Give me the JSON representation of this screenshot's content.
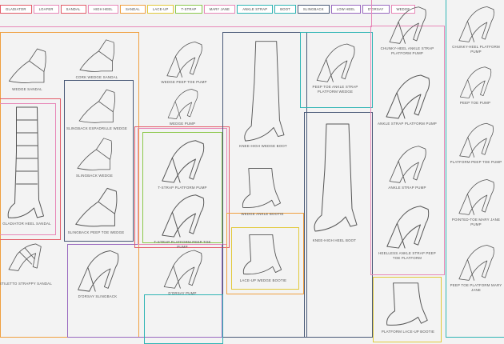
{
  "colors": {
    "red": "#e35d6a",
    "pink": "#e888b8",
    "orange": "#f0a040",
    "yellow": "#e2c93a",
    "green": "#8cc84b",
    "teal": "#2fb5b5",
    "navy": "#4a5a78",
    "purple": "#9a6ac0",
    "gray": "#888888"
  },
  "legend": [
    {
      "label": "Gladiator",
      "color": "red"
    },
    {
      "label": "Loafer",
      "color": "pink"
    },
    {
      "label": "Sandal",
      "color": "red"
    },
    {
      "label": "High Heel",
      "color": "pink"
    },
    {
      "label": "Sandal",
      "color": "orange"
    },
    {
      "label": "Lace-Up",
      "color": "yellow"
    },
    {
      "label": "T-Strap",
      "color": "green"
    },
    {
      "label": "Mary Jane",
      "color": "pink"
    },
    {
      "label": "Ankle Strap",
      "color": "teal"
    },
    {
      "label": "Boot",
      "color": "teal"
    },
    {
      "label": "Slingback",
      "color": "navy"
    },
    {
      "label": "Low Heel",
      "color": "purple"
    },
    {
      "label": "D'orsay",
      "color": "purple"
    },
    {
      "label": "Wedge",
      "color": "pink"
    }
  ],
  "shoes": [
    {
      "id": "wedge-sandal",
      "label": "Wedge Sandal"
    },
    {
      "id": "gladiator-heel-sandal",
      "label": "Gladiator Heel Sandal"
    },
    {
      "id": "stiletto-strappy-sandal",
      "label": "Stiletto Strappy Sandal"
    },
    {
      "id": "cork-wedge-sandal",
      "label": "Cork Wedge Sandal"
    },
    {
      "id": "slingback-espadrille-wedge",
      "label": "Slingback Espadrille Wedge"
    },
    {
      "id": "slingback-wedge",
      "label": "Slingback Wedge"
    },
    {
      "id": "slingback-peep-toe-wedge",
      "label": "Slingback Peep Toe Wedge"
    },
    {
      "id": "dorsay-slingback",
      "label": "D'orsay Slingback"
    },
    {
      "id": "wedge-peep-toe-pump",
      "label": "Wedge Peep Toe Pump"
    },
    {
      "id": "wedge-pump",
      "label": "Wedge Pump"
    },
    {
      "id": "t-strap-platform-pump",
      "label": "T-Strap Platform Pump"
    },
    {
      "id": "t-strap-platform-peep-toe-pump",
      "label": "T-Strap Platform Peep Toe Pump"
    },
    {
      "id": "dorsay-pump",
      "label": "D'orsay Pump"
    },
    {
      "id": "knee-high-wedge-boot",
      "label": "Knee-High Wedge Boot"
    },
    {
      "id": "wedge-ankle-bootie",
      "label": "Wedge Ankle Bootie"
    },
    {
      "id": "lace-up-wedge-bootie",
      "label": "Lace-Up Wedge Bootie"
    },
    {
      "id": "peep-toe-ankle-strap-platform-wedge",
      "label": "Peep Toe Ankle Strap Platform Wedge"
    },
    {
      "id": "knee-high-heel-boot",
      "label": "Knee-High Heel Boot"
    },
    {
      "id": "chunky-heel-ankle-strap-platform-pump",
      "label": "Chunky-Heel Ankle Strap Platform Pump"
    },
    {
      "id": "ankle-strap-platform-pump",
      "label": "Ankle Strap Platform Pump"
    },
    {
      "id": "ankle-strap-pump",
      "label": "Ankle Strap Pump"
    },
    {
      "id": "heelless-ankle-strap-peep-toe-platform",
      "label": "Heelless Ankle Strap Peep Toe Platform"
    },
    {
      "id": "platform-lace-up-bootie",
      "label": "Platform Lace-Up Bootie"
    },
    {
      "id": "chunky-heel-platform-pump",
      "label": "Chunky-Heel Platform Pump"
    },
    {
      "id": "peep-toe-pump",
      "label": "Peep Toe Pump"
    },
    {
      "id": "platform-peep-toe-pump",
      "label": "Platform Peep Toe Pump"
    },
    {
      "id": "pointed-toe-mary-jane-pump",
      "label": "Pointed-Toe Mary Jane Pump"
    },
    {
      "id": "peep-toe-platform-mary-jane",
      "label": "Peep Toe Platform Mary Jane"
    }
  ]
}
